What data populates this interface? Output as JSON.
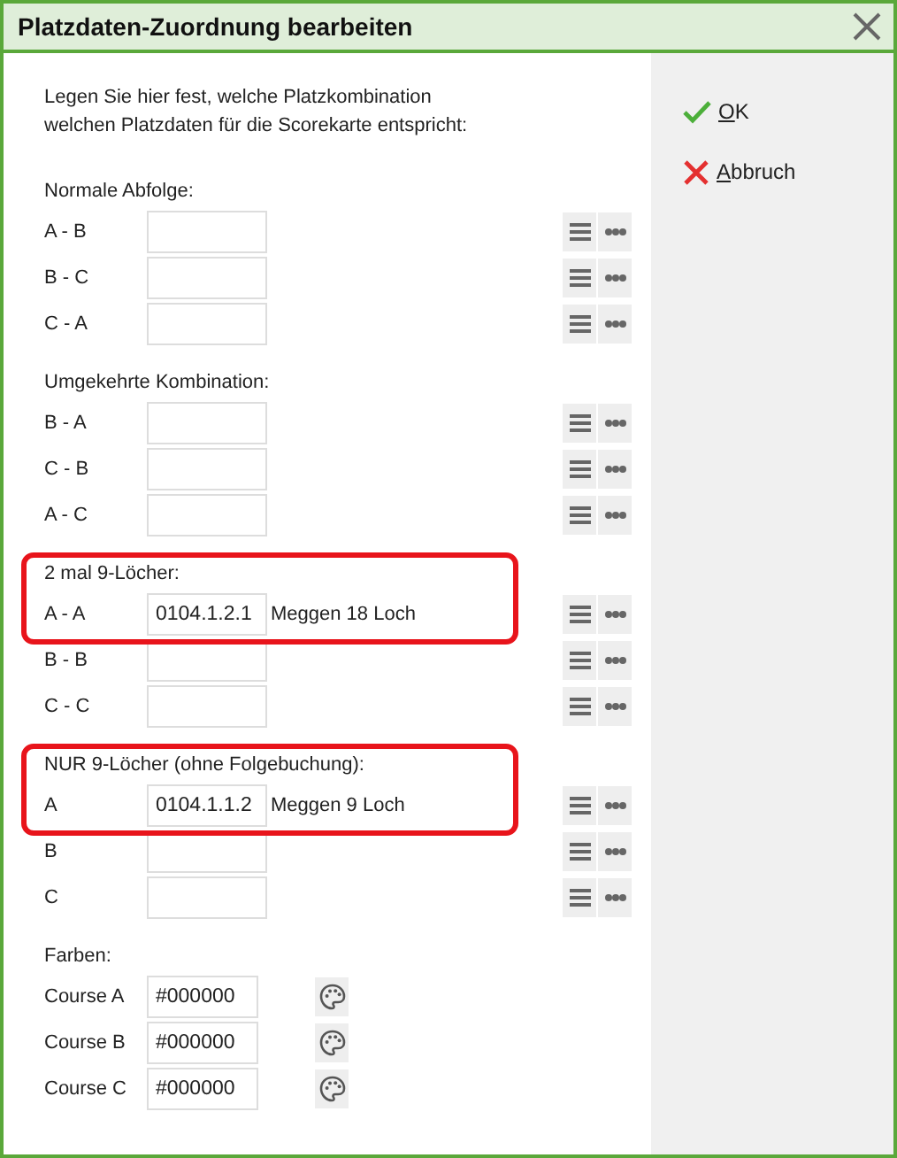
{
  "window": {
    "title": "Platzdaten-Zuordnung bearbeiten"
  },
  "intro": "Legen Sie hier fest, welche Platzkombination welchen Platzdaten für die Scorekarte entspricht:",
  "groups": [
    {
      "title": "Normale Abfolge:",
      "highlighted": false,
      "rows": [
        {
          "label": "A - B"
        },
        {
          "label": "B - C"
        },
        {
          "label": "C - A"
        }
      ]
    },
    {
      "title": "Umgekehrte Kombination:",
      "highlighted": false,
      "rows": [
        {
          "label": "B - A"
        },
        {
          "label": "C - B"
        },
        {
          "label": "A - C"
        }
      ]
    },
    {
      "title": "2 mal 9-Löcher:",
      "highlighted": true,
      "rows": [
        {
          "label": "A - A",
          "value": "0104.1.2.1",
          "description": "Meggen 18 Loch"
        },
        {
          "label": "B - B"
        },
        {
          "label": "C - C"
        }
      ]
    },
    {
      "title": "NUR 9-Löcher (ohne Folgebuchung):",
      "highlighted": true,
      "rows": [
        {
          "label": "A",
          "value": "0104.1.1.2",
          "description": "Meggen 9 Loch"
        },
        {
          "label": "B"
        },
        {
          "label": "C"
        }
      ]
    }
  ],
  "colors": {
    "title": "Farben:",
    "rows": [
      {
        "label": "Course A",
        "value": "#000000"
      },
      {
        "label": "Course B",
        "value": "#000000"
      },
      {
        "label": "Course C",
        "value": "#000000"
      }
    ]
  },
  "actions": [
    {
      "kind": "ok",
      "label": "OK",
      "mnemonic": true
    },
    {
      "kind": "cancel",
      "label": "Abbruch",
      "mnemonic": true
    }
  ]
}
